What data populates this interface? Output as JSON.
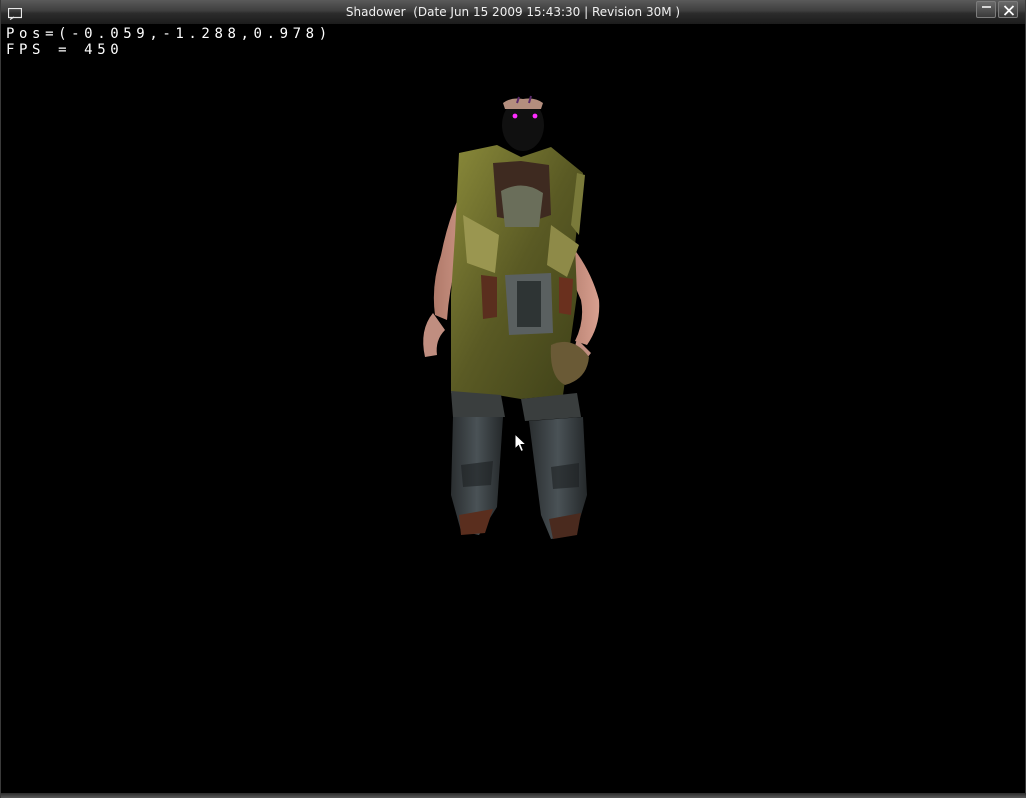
{
  "window": {
    "app_name": "Shadower",
    "build_info": "(Date Jun 15 2009 15:43:30 | Revision 30M )"
  },
  "controls": {
    "menu_icon": "window-menu-icon",
    "minimize_icon": "minimize-icon",
    "close_icon": "close-icon"
  },
  "hud": {
    "position_text": "Pos=(-0.059,-1.288,0.978)",
    "fps_text": "FPS = 450"
  },
  "scene": {
    "background_color": "#000000",
    "model": "textured-soldier-character-model"
  }
}
